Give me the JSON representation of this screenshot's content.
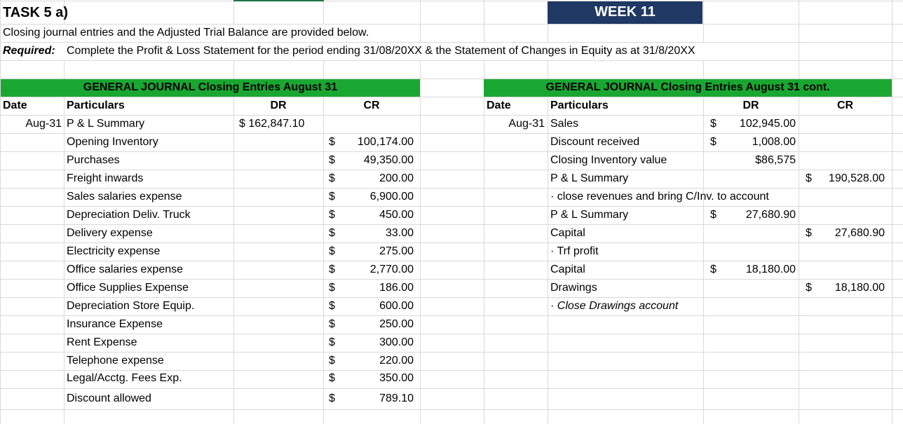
{
  "header": {
    "task": "TASK 5 a)",
    "week": "WEEK 11",
    "intro": "Closing journal entries and the Adjusted Trial Balance are provided below.",
    "required_label": "Required:",
    "required_text": "Complete the Profit & Loss Statement for the period ending 31/08/20XX & the Statement of Changes in Equity as at 31/8/20XX"
  },
  "colors": {
    "green_header": "#1aa731",
    "week_bg": "#1f3864",
    "gridline": "#d9d9d9"
  },
  "left_journal": {
    "title": "GENERAL JOURNAL Closing Entries August 31",
    "columns": {
      "date": "Date",
      "particulars": "Particulars",
      "dr": "DR",
      "cr": "CR"
    },
    "rows": [
      {
        "date": "Aug-31",
        "particulars": "P & L Summary",
        "dr": "$ 162,847.10",
        "cr_sym": "",
        "cr": ""
      },
      {
        "date": "",
        "particulars": "Opening Inventory",
        "dr": "",
        "cr_sym": "$",
        "cr": "100,174.00"
      },
      {
        "date": "",
        "particulars": "Purchases",
        "dr": "",
        "cr_sym": "$",
        "cr": "49,350.00"
      },
      {
        "date": "",
        "particulars": "Freight inwards",
        "dr": "",
        "cr_sym": "$",
        "cr": "200.00"
      },
      {
        "date": "",
        "particulars": "Sales salaries expense",
        "dr": "",
        "cr_sym": "$",
        "cr": "6,900.00"
      },
      {
        "date": "",
        "particulars": "Depreciation Deliv. Truck",
        "dr": "",
        "cr_sym": "$",
        "cr": "450.00"
      },
      {
        "date": "",
        "particulars": "Delivery expense",
        "dr": "",
        "cr_sym": "$",
        "cr": "33.00"
      },
      {
        "date": "",
        "particulars": "Electricity expense",
        "dr": "",
        "cr_sym": "$",
        "cr": "275.00"
      },
      {
        "date": "",
        "particulars": "Office salaries expense",
        "dr": "",
        "cr_sym": "$",
        "cr": "2,770.00"
      },
      {
        "date": "",
        "particulars": "Office Supplies Expense",
        "dr": "",
        "cr_sym": "$",
        "cr": "186.00"
      },
      {
        "date": "",
        "particulars": "Depreciation Store Equip.",
        "dr": "",
        "cr_sym": "$",
        "cr": "600.00"
      },
      {
        "date": "",
        "particulars": "Insurance Expense",
        "dr": "",
        "cr_sym": "$",
        "cr": "250.00"
      },
      {
        "date": "",
        "particulars": "Rent Expense",
        "dr": "",
        "cr_sym": "$",
        "cr": "300.00"
      },
      {
        "date": "",
        "particulars": "Telephone expense",
        "dr": "",
        "cr_sym": "$",
        "cr": "220.00"
      },
      {
        "date": "",
        "particulars": "Legal/Acctg. Fees Exp.",
        "dr": "",
        "cr_sym": "$",
        "cr": "350.00"
      },
      {
        "date": "",
        "particulars": "Discount allowed",
        "dr": "",
        "cr_sym": "$",
        "cr": "789.10"
      }
    ]
  },
  "right_journal": {
    "title": "GENERAL JOURNAL Closing Entries August 31 cont.",
    "columns": {
      "date": "Date",
      "particulars": "Particulars",
      "dr": "DR",
      "cr": "CR"
    },
    "rows": [
      {
        "date": "Aug-31",
        "particulars": "Sales",
        "style": "",
        "dr_sym": "$",
        "dr": "102,945.00",
        "cr_sym": "",
        "cr": ""
      },
      {
        "date": "",
        "particulars": "Discount received",
        "style": "",
        "dr_sym": "$",
        "dr": "1,008.00",
        "cr_sym": "",
        "cr": ""
      },
      {
        "date": "",
        "particulars": "Closing Inventory value",
        "style": "",
        "dr_sym": "",
        "dr": "$86,575",
        "cr_sym": "",
        "cr": ""
      },
      {
        "date": "",
        "particulars": "P & L Summary",
        "style": "",
        "dr_sym": "",
        "dr": "",
        "cr_sym": "$",
        "cr": "190,528.00"
      },
      {
        "date": "",
        "particulars": "· close revenues and bring C/Inv. to account",
        "style": "",
        "dr_sym": "",
        "dr": "",
        "cr_sym": "",
        "cr": ""
      },
      {
        "date": "",
        "particulars": "P & L Summary",
        "style": "",
        "dr_sym": "$",
        "dr": "27,680.90",
        "cr_sym": "",
        "cr": ""
      },
      {
        "date": "",
        "particulars": "Capital",
        "style": "",
        "dr_sym": "",
        "dr": "",
        "cr_sym": "$",
        "cr": "27,680.90"
      },
      {
        "date": "",
        "particulars": "· Trf profit",
        "style": "",
        "dr_sym": "",
        "dr": "",
        "cr_sym": "",
        "cr": ""
      },
      {
        "date": "",
        "particulars": "Capital",
        "style": "",
        "dr_sym": "$",
        "dr": "18,180.00",
        "cr_sym": "",
        "cr": ""
      },
      {
        "date": "",
        "particulars": "Drawings",
        "style": "",
        "dr_sym": "",
        "dr": "",
        "cr_sym": "$",
        "cr": "18,180.00"
      },
      {
        "date": "",
        "particulars": "· Close Drawings account",
        "style": "italic",
        "dr_sym": "",
        "dr": "",
        "cr_sym": "",
        "cr": ""
      }
    ]
  }
}
